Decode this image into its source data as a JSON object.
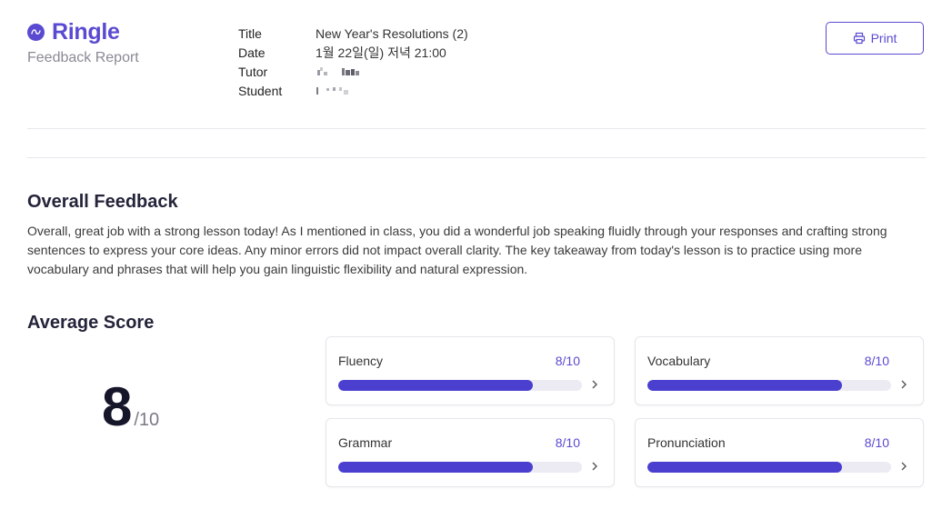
{
  "brand": {
    "name": "Ringle",
    "accent": "#5a4ad1"
  },
  "header": {
    "subtitle": "Feedback Report",
    "print_label": "Print"
  },
  "meta": [
    {
      "key": "Title",
      "value": "New Year's Resolutions (2)"
    },
    {
      "key": "Date",
      "value": "1월 22일(일) 저녁 21:00"
    },
    {
      "key": "Tutor",
      "value": ""
    },
    {
      "key": "Student",
      "value": ""
    }
  ],
  "overall": {
    "heading": "Overall Feedback",
    "text": "Overall, great job with a strong lesson today! As I mentioned in class, you did a wonderful job speaking fluidly through your responses and crafting strong sentences to express your core ideas. Any minor errors did not impact overall clarity. The key takeaway from today's lesson is to practice using more vocabulary and phrases that will help you gain linguistic flexibility and natural expression."
  },
  "average": {
    "heading": "Average Score",
    "score": "8",
    "denominator": "/10",
    "categories": [
      {
        "label": "Fluency",
        "score_text": "8/10",
        "value": 0.8
      },
      {
        "label": "Vocabulary",
        "score_text": "8/10",
        "value": 0.8
      },
      {
        "label": "Grammar",
        "score_text": "8/10",
        "value": 0.8
      },
      {
        "label": "Pronunciation",
        "score_text": "8/10",
        "value": 0.8
      }
    ]
  }
}
